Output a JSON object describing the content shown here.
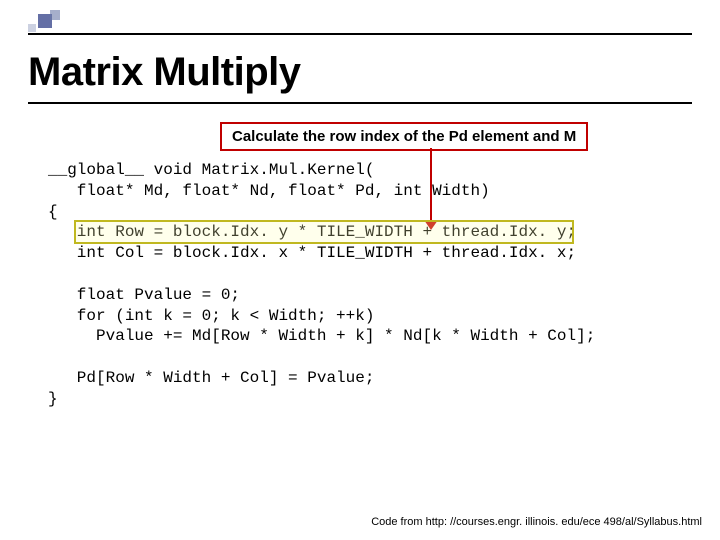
{
  "title": "Matrix Multiply",
  "callout": "Calculate the row index of the Pd element and M",
  "code": {
    "l1": "__global__ void Matrix.Mul.Kernel(",
    "l2": "   float* Md, float* Nd, float* Pd, int Width)",
    "l3": "{",
    "l4": "   int Row = block.Idx. y * TILE_WIDTH + thread.Idx. y;",
    "l5": "   int Col = block.Idx. x * TILE_WIDTH + thread.Idx. x;",
    "l6": "",
    "l7": "   float Pvalue = 0;",
    "l8": "   for (int k = 0; k < Width; ++k)",
    "l9": "     Pvalue += Md[Row * Width + k] * Nd[k * Width + Col];",
    "l10": "",
    "l11": "   Pd[Row * Width + Col] = Pvalue;",
    "l12": "}"
  },
  "credit": "Code from http: //courses.engr. illinois. edu/ece 498/al/Syllabus.html"
}
